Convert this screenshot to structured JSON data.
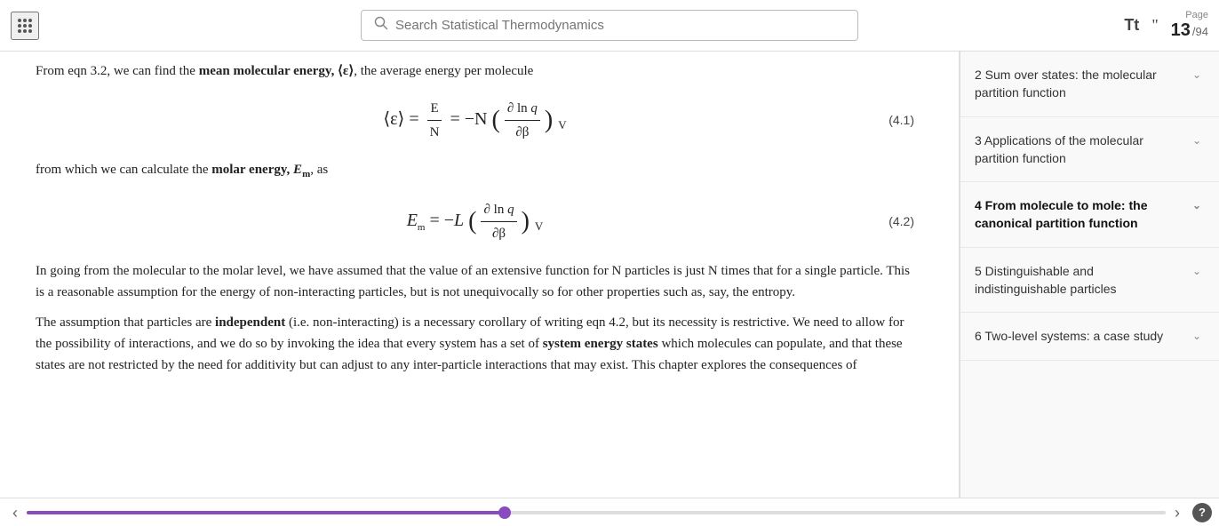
{
  "topbar": {
    "search_placeholder": "Search Statistical Thermodynamics",
    "tt_label": "Tt",
    "quote_label": "\"",
    "page_label": "Page",
    "current_page": "13",
    "total_pages": "/94"
  },
  "content": {
    "para1": "From eqn 3.2, we can find the mean molecular energy, ⟨ε⟩, the average energy per molecule",
    "eq1_label": "(4.1)",
    "eq2_label": "(4.2)",
    "para2": "from which we can calculate the molar energy, E",
    "para2_sub": "m",
    "para2_end": ", as",
    "para3": "In going from the molecular to the molar level, we have assumed that the value of an extensive function for N particles is just N times that for a single particle. This is a reasonable assumption for the energy of non-interacting particles, but is not unequivocally so for other properties such as, say, the entropy.",
    "para4_start": "The assumption that particles are ",
    "para4_bold": "independent",
    "para4_mid": " (i.e. non-interacting) is a necessary corollary of writing eqn 4.2, but its necessity is restrictive. We need to allow for the possibility of interactions, and we do so by invoking the idea that every system has a set of ",
    "para4_bold2": "system energy states",
    "para4_end": " which molecules can populate, and that these states are not restricted by the need for additivity but can adjust to any inter-particle interactions that may exist. This chapter explores the consequences of"
  },
  "sidebar": {
    "items": [
      {
        "id": "item1",
        "label": "2 Sum over states: the molecular partition function",
        "active": false,
        "expanded": false
      },
      {
        "id": "item2",
        "label": "3 Applications of the molecular partition function",
        "active": false,
        "expanded": false
      },
      {
        "id": "item3",
        "label": "4 From molecule to mole: the canonical partition function",
        "active": true,
        "expanded": false
      },
      {
        "id": "item4",
        "label": "5 Distinguishable and indistinguishable particles",
        "active": false,
        "expanded": false
      },
      {
        "id": "item5",
        "label": "6 Two-level systems: a case study",
        "active": false,
        "expanded": false
      }
    ]
  },
  "bottombar": {
    "progress_percent": 42,
    "prev_label": "‹",
    "next_label": "›",
    "help_label": "?"
  }
}
